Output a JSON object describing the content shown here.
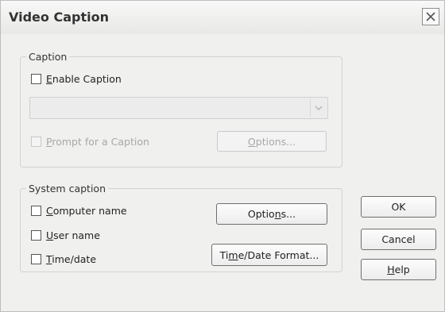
{
  "window": {
    "title": "Video Caption"
  },
  "caption_group": {
    "legend": "Caption",
    "enable_caption": {
      "pre": "",
      "key": "E",
      "post": "nable Caption",
      "checked": false
    },
    "caption_select": {
      "value": "",
      "enabled": false
    },
    "prompt_caption": {
      "pre": "",
      "key": "P",
      "post": "rompt for a Caption",
      "checked": false,
      "enabled": false
    },
    "options_button": {
      "pre": "",
      "key": "O",
      "post": "ptions...",
      "enabled": false
    }
  },
  "system_group": {
    "legend": "System caption",
    "computer_name": {
      "pre": "",
      "key": "C",
      "post": "omputer name",
      "checked": false
    },
    "user_name": {
      "pre": "",
      "key": "U",
      "post": "ser name",
      "checked": false
    },
    "time_date": {
      "pre": "",
      "key": "T",
      "post": "ime/date",
      "checked": false
    },
    "options_button": {
      "pre": "Optio",
      "key": "n",
      "post": "s..."
    },
    "time_format_button": {
      "pre": "Ti",
      "key": "m",
      "post": "e/Date Format..."
    }
  },
  "buttons": {
    "ok": "OK",
    "cancel": "Cancel",
    "help": {
      "pre": "",
      "key": "H",
      "post": "elp"
    }
  }
}
